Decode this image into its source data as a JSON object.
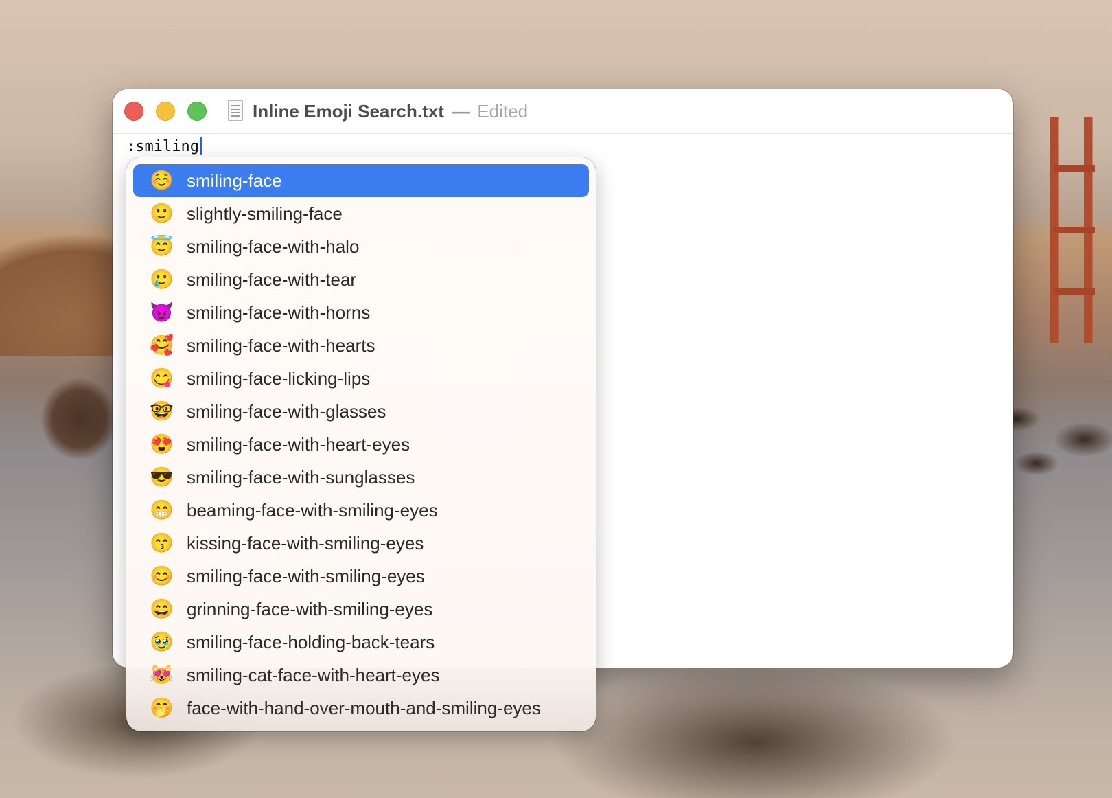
{
  "window": {
    "filename": "Inline Emoji Search.txt",
    "separator": "—",
    "status": "Edited"
  },
  "editor": {
    "text": ":smiling"
  },
  "suggestions": {
    "selected_index": 0,
    "items": [
      {
        "emoji": "☺️",
        "label": "smiling-face"
      },
      {
        "emoji": "🙂",
        "label": "slightly-smiling-face"
      },
      {
        "emoji": "😇",
        "label": "smiling-face-with-halo"
      },
      {
        "emoji": "🥲",
        "label": "smiling-face-with-tear"
      },
      {
        "emoji": "😈",
        "label": "smiling-face-with-horns"
      },
      {
        "emoji": "🥰",
        "label": "smiling-face-with-hearts"
      },
      {
        "emoji": "😋",
        "label": "smiling-face-licking-lips"
      },
      {
        "emoji": "🤓",
        "label": "smiling-face-with-glasses"
      },
      {
        "emoji": "😍",
        "label": "smiling-face-with-heart-eyes"
      },
      {
        "emoji": "😎",
        "label": "smiling-face-with-sunglasses"
      },
      {
        "emoji": "😁",
        "label": "beaming-face-with-smiling-eyes"
      },
      {
        "emoji": "😙",
        "label": "kissing-face-with-smiling-eyes"
      },
      {
        "emoji": "😊",
        "label": "smiling-face-with-smiling-eyes"
      },
      {
        "emoji": "😄",
        "label": "grinning-face-with-smiling-eyes"
      },
      {
        "emoji": "🥹",
        "label": "smiling-face-holding-back-tears"
      },
      {
        "emoji": "😻",
        "label": "smiling-cat-face-with-heart-eyes"
      },
      {
        "emoji": "🤭",
        "label": "face-with-hand-over-mouth-and-smiling-eyes"
      }
    ]
  },
  "colors": {
    "selection": "#3b7cf0",
    "close": "#ec5f58",
    "minimize": "#f5c13a",
    "zoom": "#5ec457",
    "caret": "#1f64e6"
  }
}
